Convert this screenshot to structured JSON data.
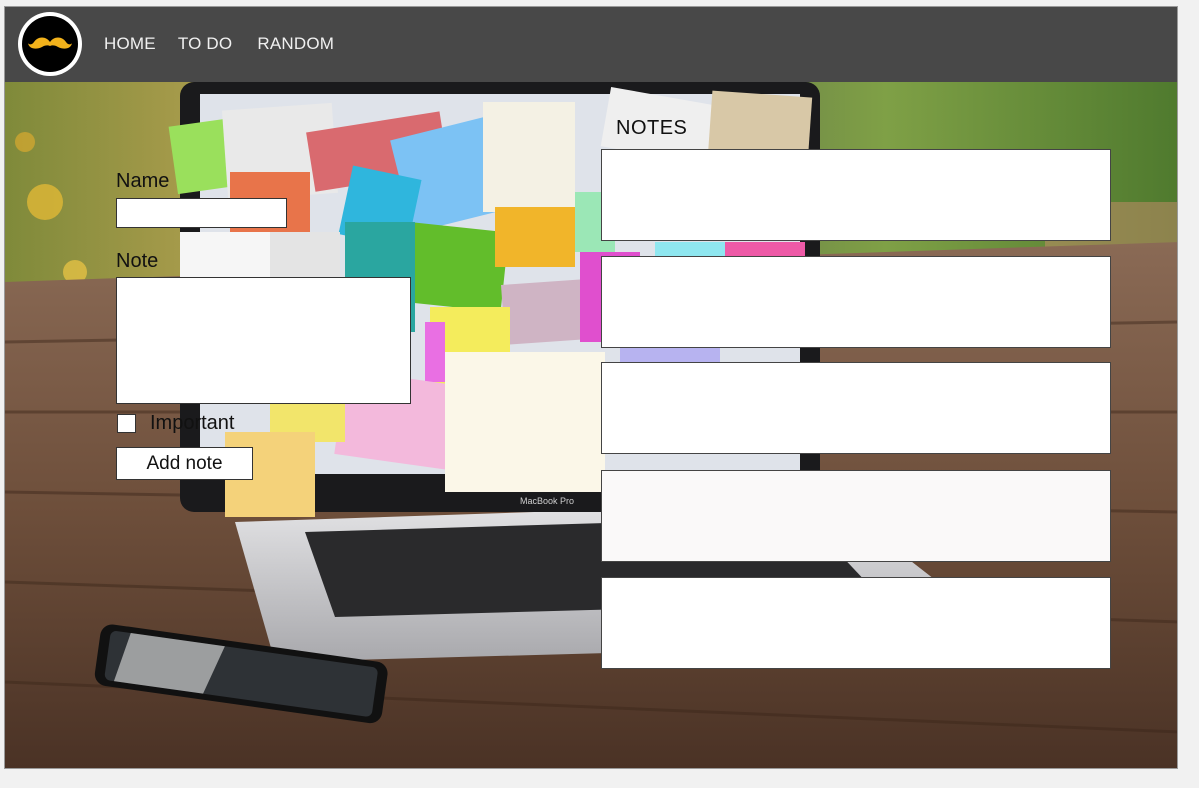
{
  "nav": {
    "logo_icon": "mustache-icon",
    "links": [
      "HOME",
      "TO DO",
      "RANDOM"
    ]
  },
  "form": {
    "name_label": "Name",
    "name_value": "",
    "note_label": "Note",
    "note_value": "",
    "important_label": "Important",
    "important_checked": false,
    "add_button_label": "Add note"
  },
  "notes": {
    "title": "NOTES",
    "items": [
      "",
      "",
      "",
      "",
      ""
    ]
  },
  "colors": {
    "navbar": "#484848",
    "accent_mustache": "#f2b21b"
  }
}
